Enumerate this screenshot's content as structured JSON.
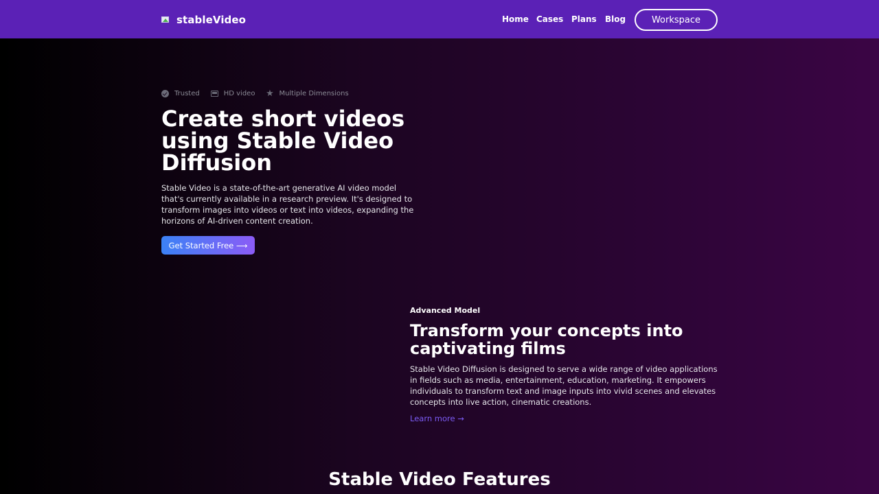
{
  "header": {
    "brand": "stableVideo",
    "nav": [
      "Home",
      "Cases",
      "Plans",
      "Blog"
    ],
    "workspace_label": "Workspace",
    "bg_color": "#5b21b6"
  },
  "hero": {
    "badges": [
      {
        "icon": "check-circle-icon",
        "label": "Trusted"
      },
      {
        "icon": "film-icon",
        "label": "HD video"
      },
      {
        "icon": "star-icon",
        "label": "Multiple Dimensions"
      }
    ],
    "title": "Create short videos using Stable Video Diffusion",
    "description": "Stable Video is a state-of-the-art generative AI video model that's currently available in a research preview. It's designed to transform images into videos or text into videos, expanding the horizons of AI-driven content creation.",
    "cta_label": "Get Started Free ⟶"
  },
  "advanced": {
    "eyebrow": "Advanced Model",
    "title": "Transform your concepts into captivating films",
    "description": "Stable Video Diffusion is designed to serve a wide range of video applications in fields such as media, entertainment, education, marketing. It empowers individuals to transform text and image inputs into vivid scenes and elevates concepts into live action, cinematic creations.",
    "link_label": "Learn more →"
  },
  "features": {
    "title": "Stable Video Features"
  }
}
